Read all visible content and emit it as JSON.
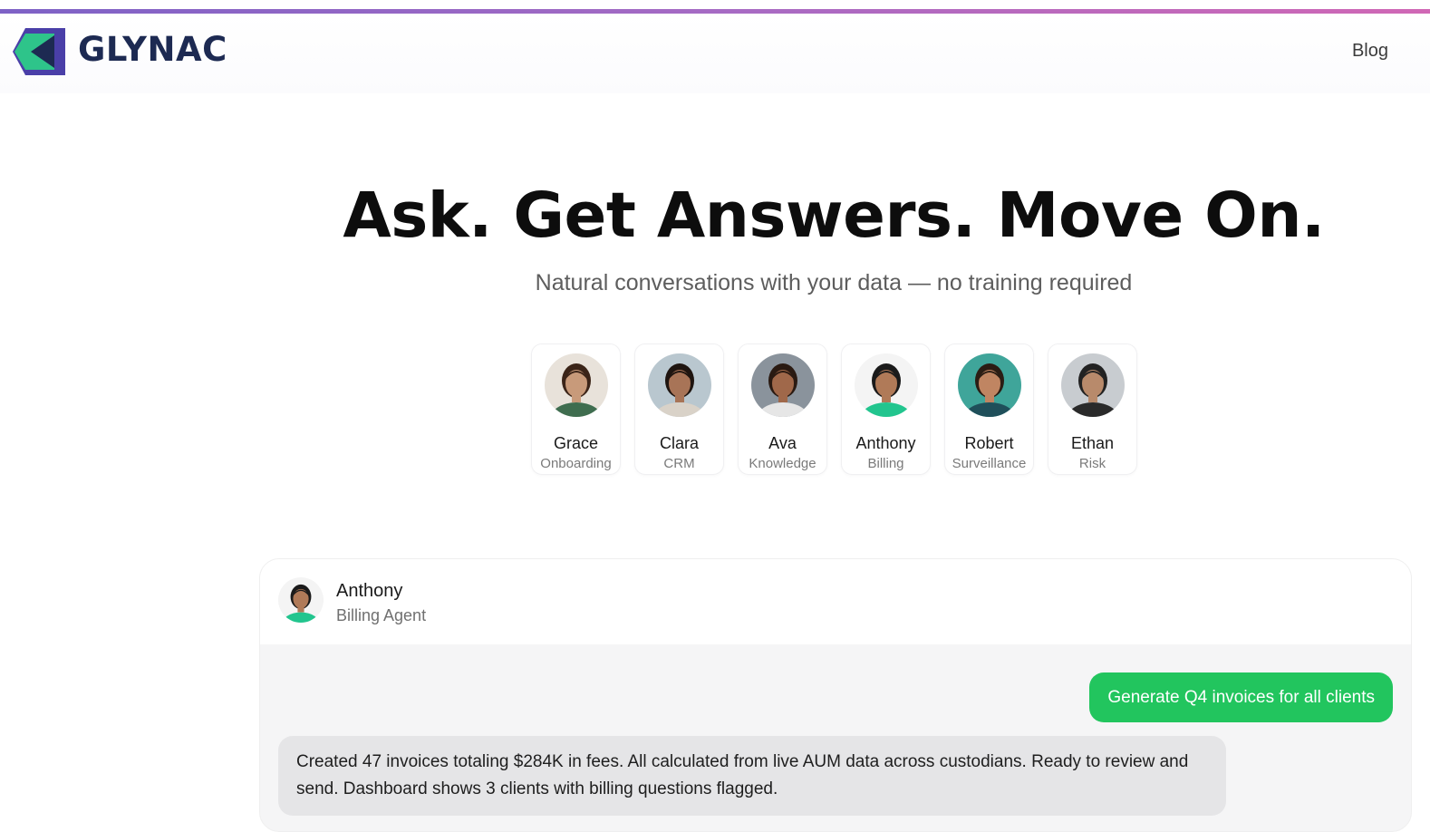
{
  "header": {
    "brand": "GLYNAC",
    "nav_blog": "Blog"
  },
  "hero": {
    "title": "Ask. Get Answers. Move On.",
    "subtitle": "Natural conversations with your data — no training required"
  },
  "agents": [
    {
      "name": "Grace",
      "role": "Onboarding",
      "skin": "#c89a7a",
      "hair": "#3b2418",
      "shirt": "#3f6d4f",
      "bg": "#e8e2da",
      "selected": false
    },
    {
      "name": "Clara",
      "role": "CRM",
      "skin": "#a87457",
      "hair": "#1f1510",
      "shirt": "#d9d2c8",
      "bg": "#b9c7cf",
      "selected": false
    },
    {
      "name": "Ava",
      "role": "Knowledge",
      "skin": "#a0684a",
      "hair": "#2a1a12",
      "shirt": "#e6e6e6",
      "bg": "#8a939c",
      "selected": false
    },
    {
      "name": "Anthony",
      "role": "Billing",
      "skin": "#b07a58",
      "hair": "#1b1b1b",
      "shirt": "#22c58e",
      "bg": "#f4f4f4",
      "selected": true
    },
    {
      "name": "Robert",
      "role": "Surveillance",
      "skin": "#c08562",
      "hair": "#2b1d14",
      "shirt": "#1f4f5a",
      "bg": "#3fa59a",
      "selected": false
    },
    {
      "name": "Ethan",
      "role": "Risk",
      "skin": "#b88a6b",
      "hair": "#222222",
      "shirt": "#2a2a2a",
      "bg": "#c8ccd0",
      "selected": false
    }
  ],
  "chat": {
    "agent_name": "Anthony",
    "agent_role": "Billing Agent",
    "user_message": "Generate Q4 invoices for all clients",
    "agent_message": "Created 47 invoices totaling $284K in fees. All calculated from live AUM data across custodians. Ready to review and send. Dashboard shows 3 clients with billing questions flagged."
  },
  "colors": {
    "accent_green": "#22c55e",
    "brand_navy": "#1d2a52",
    "selected_card": "#dde9fb"
  }
}
